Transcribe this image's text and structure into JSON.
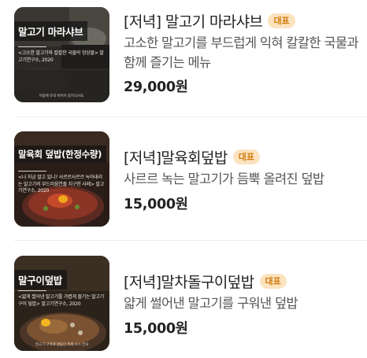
{
  "menu": [
    {
      "title": "[저녁] 말고기 마라샤브",
      "badge": "대표",
      "description": "고소한 말고기를 부드럽게 익혀 칼칼한 국물과 함께 즐기는 메뉴",
      "price": "29,000원",
      "thumbnail": {
        "label": "말고기 마라샤브",
        "quote": "<고소한 말고기와 칼칼한 국물의 엉상몰> 말고기연구소, 2020",
        "footer": "이용에 유의 바이어 참치식사요."
      }
    },
    {
      "title": "[저녁]말육회덮밥",
      "badge": "대표",
      "description": "사르르 녹는 말고기가 듬뿍 올려진 덮밥",
      "price": "15,000원",
      "thumbnail": {
        "label": "말육회 덮밥(한정수량)",
        "quote": "<나 지금 말고 있니? 사르르사르르 녹아내리는 말고기의 부드러움연출 지구한 사례> 말고기연구소, 2020",
        "footer": ""
      }
    },
    {
      "title": "[저녁]말차돌구이덮밥",
      "badge": "대표",
      "description": "얇게 썰어낸 말고기를 구워낸 덮밥",
      "price": "15,000원",
      "thumbnail": {
        "label": "말구이덮밥",
        "quote": "<얇게 썰어낸 말고기를 가볍게 즐기는 말고기 구이 덮밥> 말고기연구소, 2020",
        "footer": "말고기 구이에 곁들인 특제 소스 안내"
      }
    }
  ]
}
